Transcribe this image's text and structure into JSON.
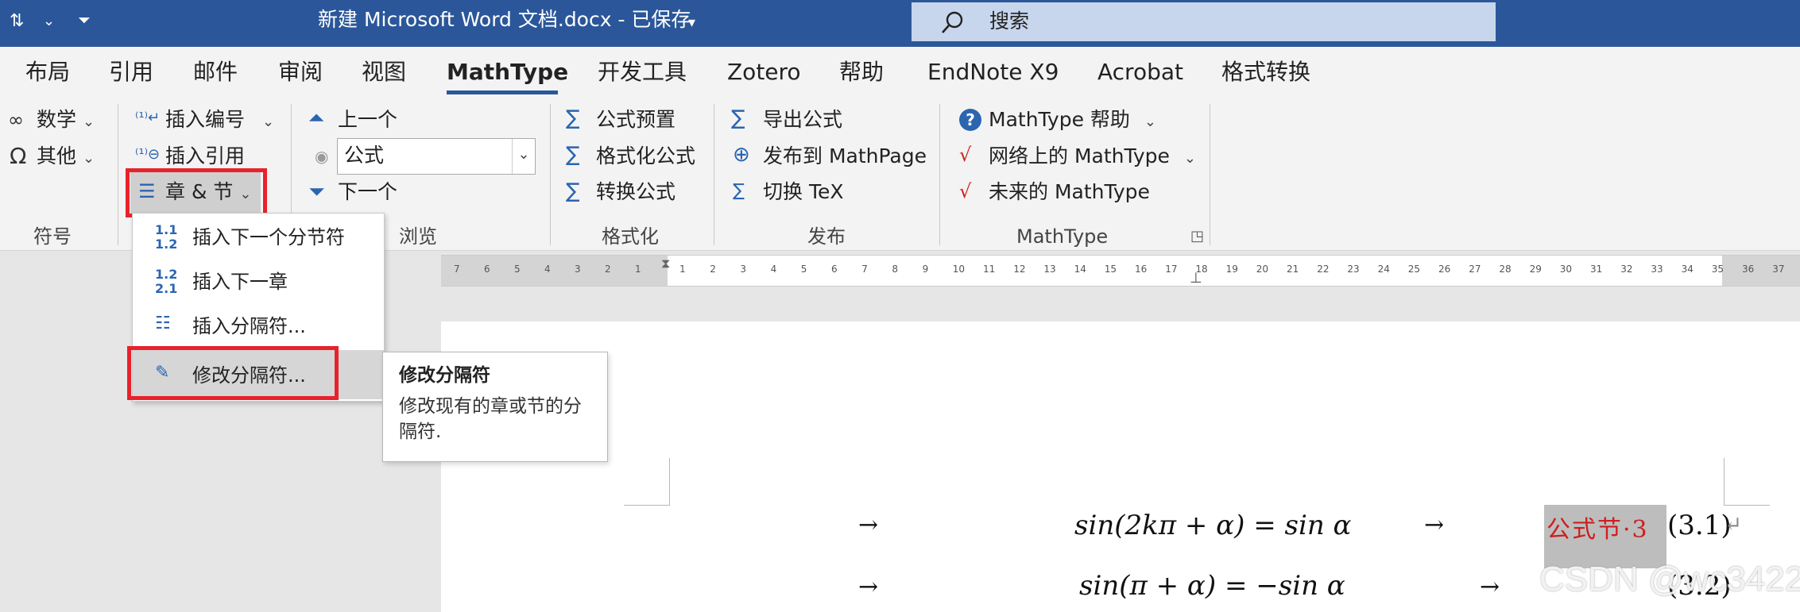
{
  "titlebar": {
    "doc_title": "新建 Microsoft Word 文档.docx  -  已保存",
    "search_placeholder": "搜索"
  },
  "tabs": [
    "布局",
    "引用",
    "邮件",
    "审阅",
    "视图",
    "MathType",
    "开发工具",
    "Zotero",
    "帮助",
    "EndNote X9",
    "Acrobat",
    "格式转换"
  ],
  "active_tab": "MathType",
  "ribbon": {
    "symbols": {
      "math_label": "数学",
      "other_label": "其他",
      "group": "符号"
    },
    "equation_numbers": {
      "insert_number": "插入编号",
      "insert_reference": "插入引用",
      "chapter_section": "章 & 节"
    },
    "browse": {
      "previous": "上一个",
      "next": "下一个",
      "combo_value": "公式",
      "group": "浏览"
    },
    "format": {
      "preset": "公式预置",
      "format_equations": "格式化公式",
      "convert": "转换公式",
      "group": "格式化"
    },
    "publish": {
      "export": "导出公式",
      "publish_mathpage": "发布到 MathPage",
      "toggle_tex": "切换 TeX",
      "group": "发布"
    },
    "mathtype": {
      "help": "MathType 帮助",
      "online": "网络上的 MathType",
      "future": "未来的 MathType",
      "group": "MathType"
    }
  },
  "dropdown": {
    "items": [
      {
        "label": "插入下一个分节符",
        "icon": "1.1/1.2"
      },
      {
        "label": "插入下一章",
        "icon": "1.2/2.1"
      },
      {
        "label": "插入分隔符...",
        "icon": "break-icon"
      },
      {
        "label": "修改分隔符...",
        "icon": "edit-break-icon"
      }
    ]
  },
  "tooltip": {
    "title": "修改分隔符",
    "body": "修改现有的章或节的分隔符."
  },
  "ruler": {
    "left_numbers": [
      "7",
      "6",
      "5",
      "4",
      "3",
      "2",
      "1"
    ],
    "right_numbers": [
      "1",
      "2",
      "3",
      "4",
      "5",
      "6",
      "7",
      "8",
      "9",
      "10",
      "11",
      "12",
      "13",
      "14",
      "15",
      "16",
      "17",
      "18",
      "19",
      "20",
      "21",
      "22",
      "23",
      "24",
      "25",
      "26",
      "27",
      "28",
      "29",
      "30",
      "31",
      "32",
      "33",
      "34",
      "35",
      "36",
      "37"
    ]
  },
  "document": {
    "eq1": "sin(2kπ + α) = sin α",
    "eq1_label_text": "公式节·3",
    "eq1_number": "(3.1)",
    "eq2": "sin(π + α) = −sin α",
    "eq2_number": "(3.2)",
    "tab_arrow": "→",
    "return_mark": "↵"
  },
  "watermark": "CSDN @wc3422",
  "colors": {
    "title_bar": "#2b579a",
    "highlight_red": "#e8222b",
    "equation_label_red": "#cc1f1f"
  }
}
